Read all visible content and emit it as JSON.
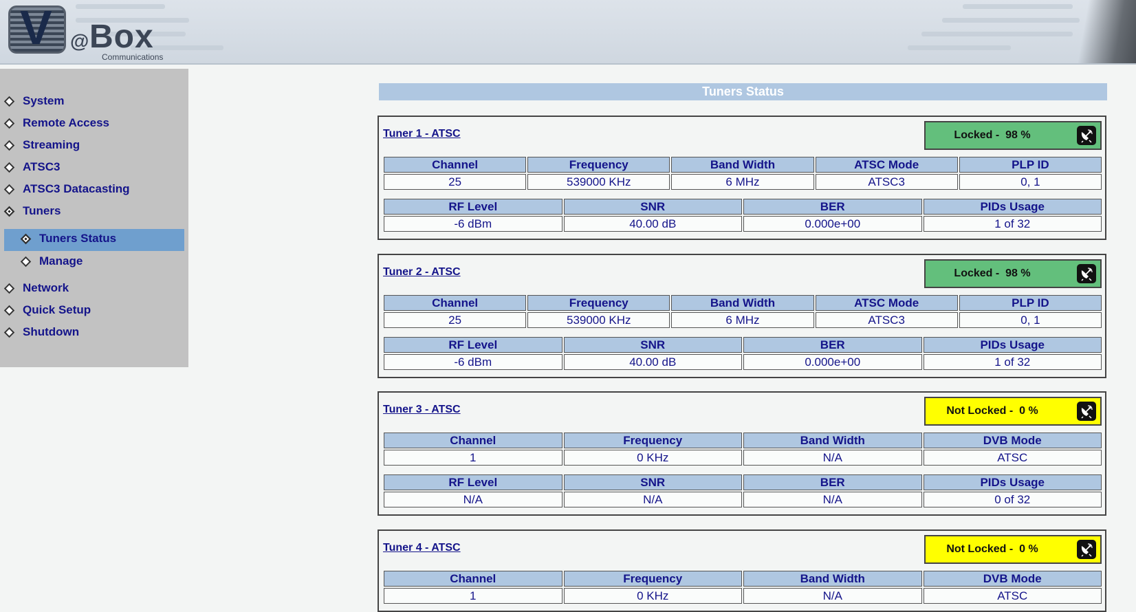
{
  "header": {
    "brand": "V@Box",
    "brand_at": "@",
    "brand_box": "Box",
    "brand_sub": "Communications"
  },
  "sidebar": {
    "items": [
      {
        "label": "System"
      },
      {
        "label": "Remote Access"
      },
      {
        "label": "Streaming"
      },
      {
        "label": "ATSC3"
      },
      {
        "label": "ATSC3 Datacasting"
      },
      {
        "label": "Tuners"
      },
      {
        "label": "Tuners Status",
        "selected": true
      },
      {
        "label": "Manage"
      },
      {
        "label": "Network"
      },
      {
        "label": "Quick Setup"
      },
      {
        "label": "Shutdown"
      }
    ]
  },
  "main": {
    "title": "Tuners Status",
    "tuners": [
      {
        "name": "Tuner 1 - ATSC",
        "status": "Locked -  98 %",
        "status_color": "#63bf7c",
        "row1_headers": [
          "Channel",
          "Frequency",
          "Band Width",
          "ATSC Mode",
          "PLP ID"
        ],
        "row1_values": [
          "25",
          "539000 KHz",
          "6 MHz",
          "ATSC3",
          "0, 1"
        ],
        "row2_headers": [
          "RF Level",
          "SNR",
          "BER",
          "PIDs Usage"
        ],
        "row2_values": [
          "-6 dBm",
          "40.00 dB",
          "0.000e+00",
          "1 of 32"
        ]
      },
      {
        "name": "Tuner 2 - ATSC",
        "status": "Locked -  98 %",
        "status_color": "#63bf7c",
        "row1_headers": [
          "Channel",
          "Frequency",
          "Band Width",
          "ATSC Mode",
          "PLP ID"
        ],
        "row1_values": [
          "25",
          "539000 KHz",
          "6 MHz",
          "ATSC3",
          "0, 1"
        ],
        "row2_headers": [
          "RF Level",
          "SNR",
          "BER",
          "PIDs Usage"
        ],
        "row2_values": [
          "-6 dBm",
          "40.00 dB",
          "0.000e+00",
          "1 of 32"
        ]
      },
      {
        "name": "Tuner 3 - ATSC",
        "status": "Not Locked -  0 %",
        "status_color": "#ffff00",
        "row1_headers": [
          "Channel",
          "Frequency",
          "Band Width",
          "DVB Mode"
        ],
        "row1_values": [
          "1",
          "0 KHz",
          "N/A",
          "ATSC"
        ],
        "row2_headers": [
          "RF Level",
          "SNR",
          "BER",
          "PIDs Usage"
        ],
        "row2_values": [
          "N/A",
          "N/A",
          "N/A",
          "0 of 32"
        ]
      },
      {
        "name": "Tuner 4 - ATSC",
        "status": "Not Locked -  0 %",
        "status_color": "#ffff00",
        "row1_headers": [
          "Channel",
          "Frequency",
          "Band Width",
          "DVB Mode"
        ],
        "row1_values": [
          "1",
          "0 KHz",
          "N/A",
          "ATSC"
        ]
      }
    ]
  },
  "icons": {
    "status_icon": "satellite-dish-icon",
    "nav_bullet": "diamond-icon"
  }
}
